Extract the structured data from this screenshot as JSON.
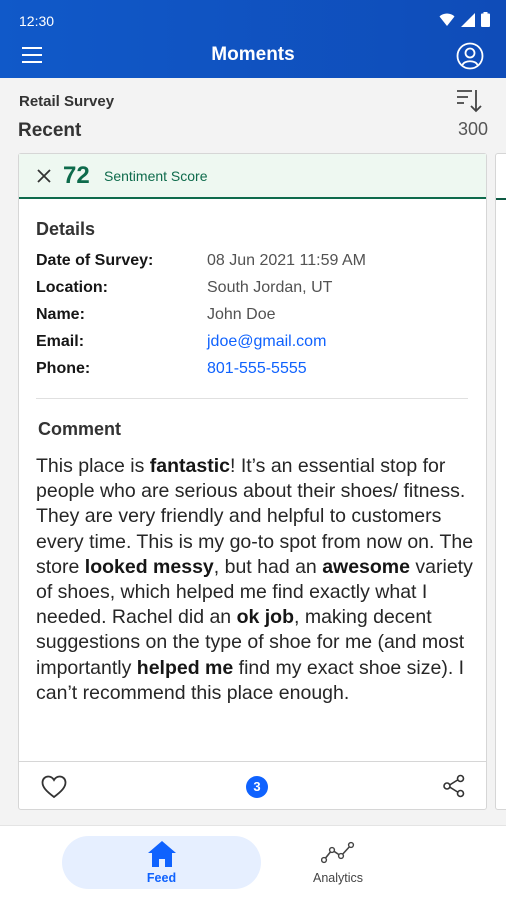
{
  "status_bar": {
    "time": "12:30"
  },
  "app_bar": {
    "title": "Moments",
    "menu_icon": "hamburger-menu-icon",
    "profile_icon": "user-avatar-icon"
  },
  "subheader": {
    "survey_name": "Retail Survey",
    "section": "Recent",
    "count": "300",
    "sort_icon": "sort-descending-icon"
  },
  "card": {
    "score": "72",
    "score_label": "Sentiment Score",
    "details_title": "Details",
    "details": [
      {
        "label": "Date of Survey:",
        "value": "08 Jun 2021 11:59 AM"
      },
      {
        "label": "Location:",
        "value": "South Jordan, UT"
      },
      {
        "label": "Name:",
        "value": "John Doe"
      },
      {
        "label": "Email:",
        "value": "jdoe@gmail.com"
      },
      {
        "label": "Phone:",
        "value": "801-555-5555"
      }
    ],
    "comment_title": "Comment",
    "comment_segments": [
      {
        "text": "This place is ",
        "bold": false
      },
      {
        "text": "fantastic",
        "bold": true
      },
      {
        "text": "! It’s an essential stop for people who are serious about their shoes/ fitness. They are very friendly and helpful to customers every time. This is my go-to spot from now on. The store ",
        "bold": false
      },
      {
        "text": "looked messy",
        "bold": true
      },
      {
        "text": ", but had an ",
        "bold": false
      },
      {
        "text": "awesome",
        "bold": true
      },
      {
        "text": " variety of shoes, which helped me find exactly what I needed. Rachel did an ",
        "bold": false
      },
      {
        "text": "ok job",
        "bold": true
      },
      {
        "text": ", making decent suggestions on the type of shoe for me (and most importantly ",
        "bold": false
      },
      {
        "text": "helped me",
        "bold": true
      },
      {
        "text": " find my exact shoe size). I can’t recommend this place enough.",
        "bold": false
      }
    ],
    "comment_count": "3"
  },
  "bottom_nav": [
    {
      "label": "Feed",
      "icon": "home-icon",
      "active": true
    },
    {
      "label": "Analytics",
      "icon": "analytics-line-icon",
      "active": false
    }
  ],
  "colors": {
    "app_bar": "#1059c9",
    "accent": "#0f62fe",
    "sentiment": "#0e6b4c"
  }
}
